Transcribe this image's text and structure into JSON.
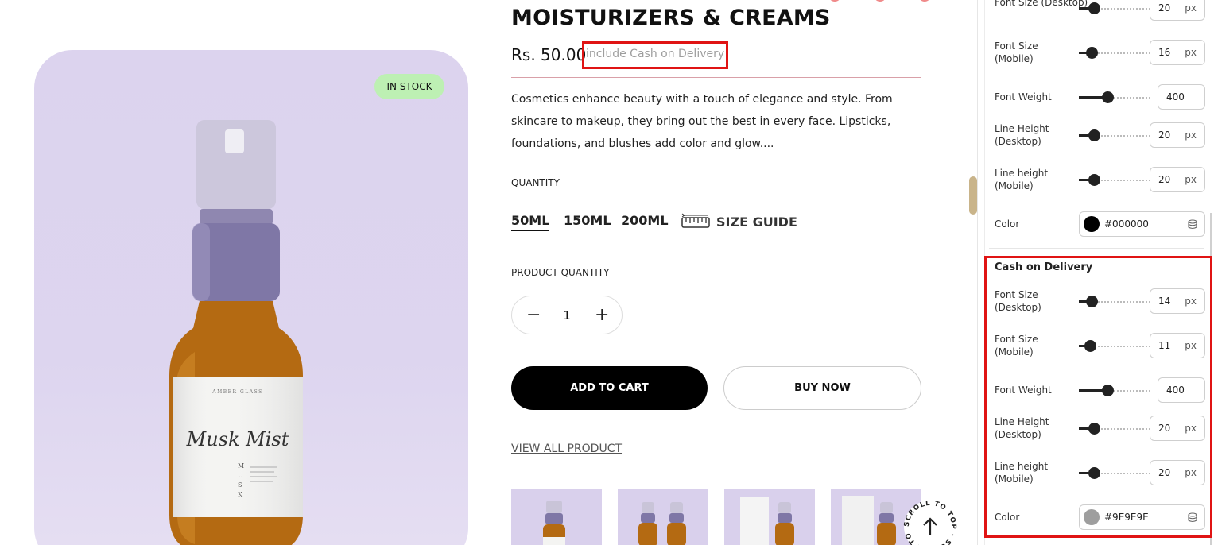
{
  "product": {
    "stock_badge": "IN STOCK",
    "title": "MOISTURIZERS & CREAMS",
    "price": "Rs. 50.00",
    "cod_text": "include Cash on Delivery",
    "description": "Cosmetics enhance beauty with a touch of elegance and style. From skincare to makeup, they bring out the best in every face. Lipsticks, foundations, and blushes add color and glow....",
    "quantity_label": "QUANTITY",
    "variants": [
      "50ML",
      "150ML",
      "200ML"
    ],
    "selected_variant": "50ML",
    "size_guide": "SIZE GUIDE",
    "product_quantity_label": "PRODUCT QUANTITY",
    "quantity_value": "1",
    "add_to_cart": "ADD TO CART",
    "buy_now": "BUY NOW",
    "view_all": "VIEW ALL PRODUCT",
    "bottle_label": {
      "brand": "AMBER GLASS",
      "name": "Musk Mist",
      "vertical": "MUSK"
    },
    "scroll_to_top": "SCROLL TO TOP · SCROLL TO TOP ·"
  },
  "settings_panel": {
    "upper": {
      "font_size_desktop": {
        "label": "Font Size (Desktop)",
        "value": "20",
        "unit": "px",
        "level": 0.22
      },
      "font_size_mobile": {
        "label": "Font Size (Mobile)",
        "value": "16",
        "unit": "px",
        "level": 0.18
      },
      "font_weight": {
        "label": "Font Weight",
        "value": "400",
        "level": 0.4
      },
      "line_height_desktop": {
        "label": "Line Height (Desktop)",
        "value": "20",
        "unit": "px",
        "level": 0.22
      },
      "line_height_mobile": {
        "label": "Line height (Mobile)",
        "value": "20",
        "unit": "px",
        "level": 0.22
      },
      "color": {
        "label": "Color",
        "value": "#000000",
        "swatch": "#000000"
      }
    },
    "cash_on_delivery": {
      "title": "Cash on Delivery",
      "font_size_desktop": {
        "label": "Font Size (Desktop)",
        "value": "14",
        "unit": "px",
        "level": 0.18
      },
      "font_size_mobile": {
        "label": "Font Size (Mobile)",
        "value": "11",
        "unit": "px",
        "level": 0.16
      },
      "font_weight": {
        "label": "Font Weight",
        "value": "400",
        "level": 0.4
      },
      "line_height_desktop": {
        "label": "Line Height (Desktop)",
        "value": "20",
        "unit": "px",
        "level": 0.22
      },
      "line_height_mobile": {
        "label": "Line height (Mobile)",
        "value": "20",
        "unit": "px",
        "level": 0.22
      },
      "color": {
        "label": "Color",
        "value": "#9E9E9E",
        "swatch": "#9e9e9e"
      }
    }
  },
  "colors": {
    "highlight": "#e01414",
    "image_background": "#dcd3ee",
    "stock_badge": "#bdf0b3",
    "slider_accent": "#c9b48a"
  }
}
